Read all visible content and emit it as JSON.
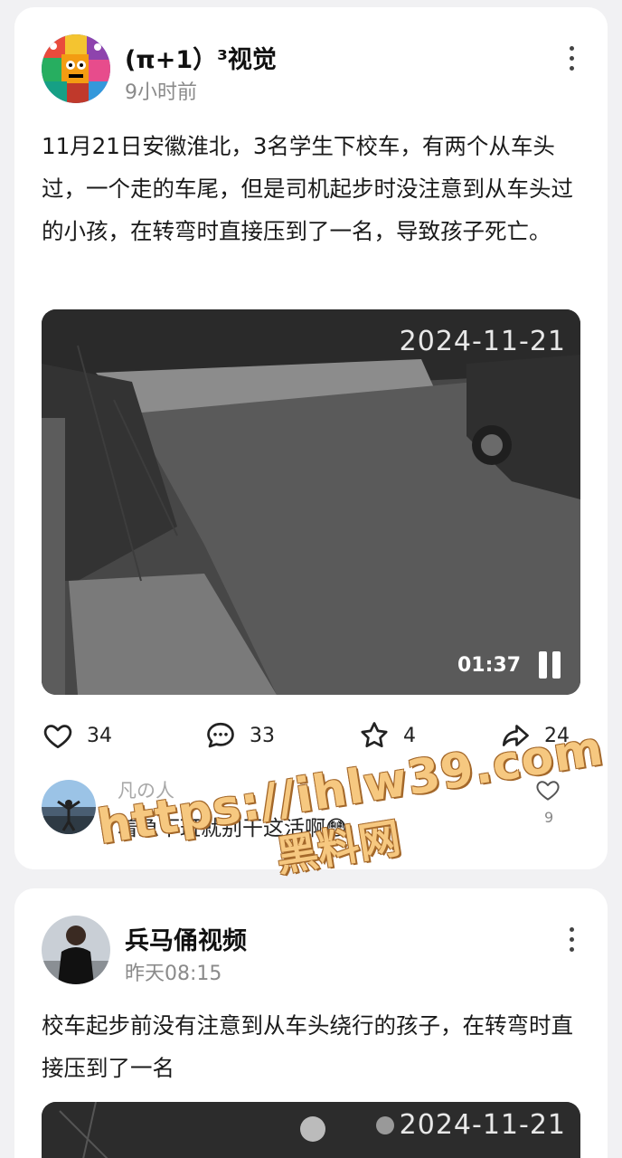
{
  "posts": [
    {
      "author": "(π+1）³视觉",
      "time": "9小时前",
      "text": "11月21日安徽淮北，3名学生下校车，有两个从车头过，一个走的车尾，但是司机起步时没注意到从车头过的小孩，在转弯时直接压到了一名，导致孩子死亡。",
      "video": {
        "date_overlay": "2024-11-21",
        "duration": "01:37",
        "state": "playing"
      },
      "stats": {
        "likes": "34",
        "comments": "33",
        "favorites": "4",
        "shares": "24"
      },
      "top_comment": {
        "user": "凡の人",
        "text": "着急下班就别干这活啊😳",
        "likes": "9"
      }
    },
    {
      "author": "兵马俑视频",
      "time": "昨天08:15",
      "text": "校车起步前没有注意到从车头绕行的孩子，在转弯时直接压到了一名",
      "video": {
        "date_overlay": "2024-11-21"
      }
    }
  ],
  "watermark": {
    "url": "https://ihlw39.com",
    "name": "黑料网"
  },
  "icons": {
    "like": "heart-icon",
    "comment": "comment-bubble-icon",
    "favorite": "star-icon",
    "share": "share-arrow-icon",
    "more": "more-vertical-icon"
  },
  "colors": {
    "background": "#f1f1f3",
    "card": "#ffffff",
    "muted": "#8a8a8a",
    "watermark": "#f6c880"
  }
}
